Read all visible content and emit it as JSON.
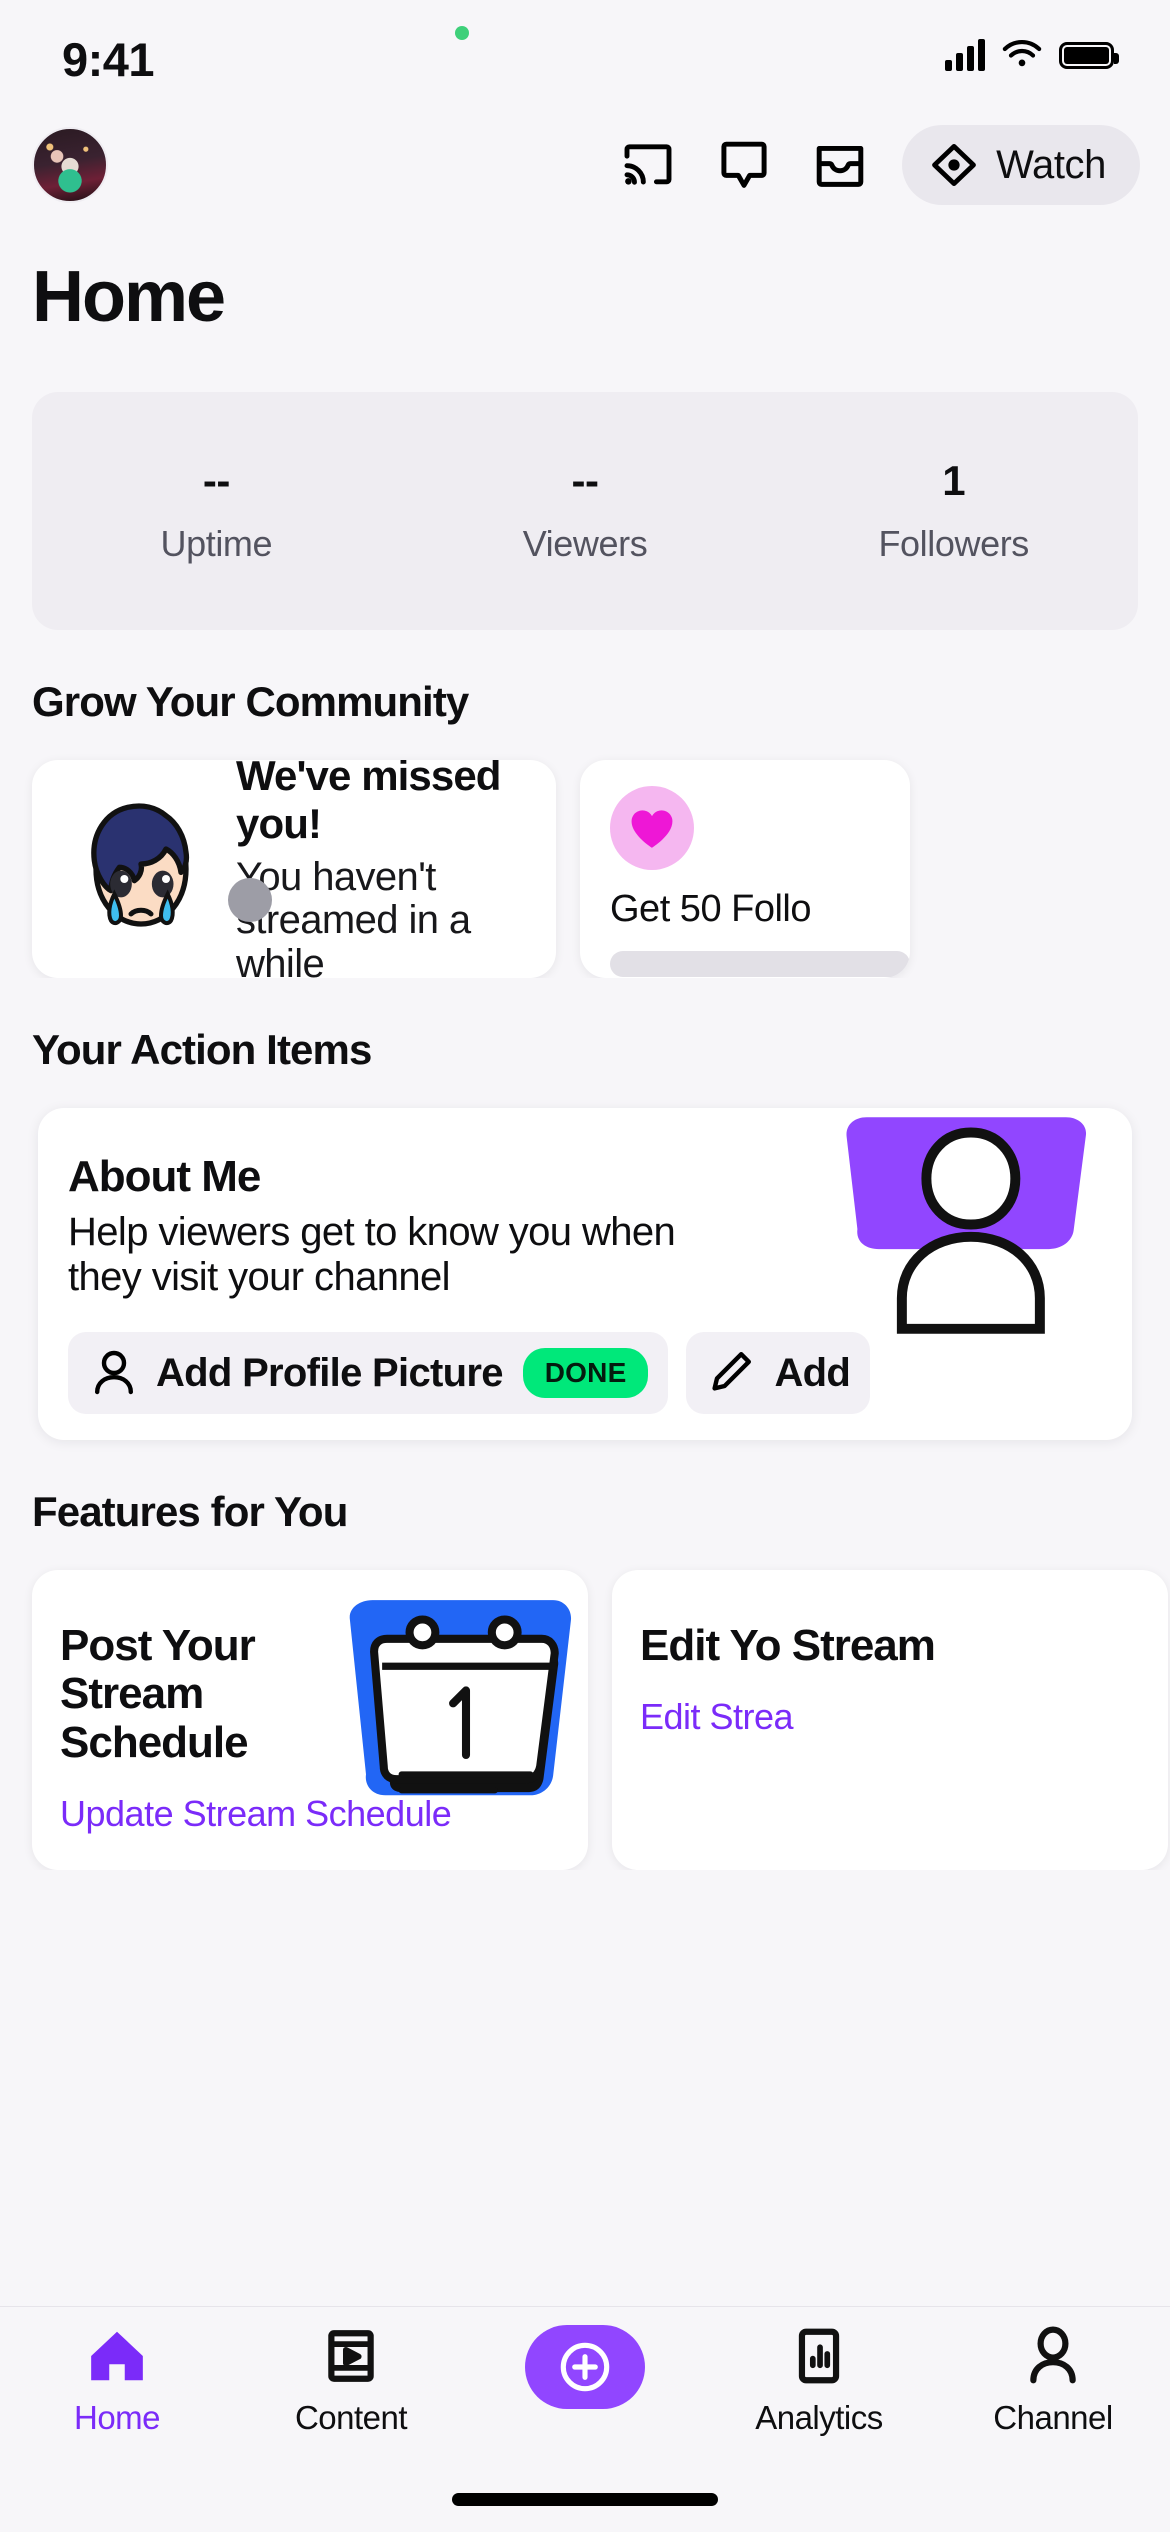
{
  "status_bar": {
    "time": "9:41",
    "icons": [
      "cellular-signal-icon",
      "wifi-icon",
      "battery-icon"
    ],
    "recording_dot": true
  },
  "app_bar": {
    "avatar": "user-avatar",
    "icons": [
      "cast-icon",
      "chat-bubble-icon",
      "inbox-icon"
    ],
    "watch_label": "Watch",
    "watch_icon": "eye-icon"
  },
  "page": {
    "title": "Home"
  },
  "stats": {
    "items": [
      {
        "value": "--",
        "label": "Uptime"
      },
      {
        "value": "--",
        "label": "Viewers"
      },
      {
        "value": "1",
        "label": "Followers"
      }
    ]
  },
  "grow": {
    "section_title": "Grow Your Community",
    "cards": [
      {
        "icon": "crying-anime-emoji",
        "title": "We've missed you!",
        "desc": "You haven't streamed in a while"
      },
      {
        "icon": "heart-icon",
        "label": "Get 50 Follo",
        "progress": 0
      }
    ]
  },
  "action_items": {
    "section_title": "Your Action Items",
    "card": {
      "title": "About Me",
      "desc": "Help viewers get to know you when they visit your channel",
      "art": "purple-person-illustration",
      "buttons": [
        {
          "icon": "person-icon",
          "label": "Add Profile Picture",
          "badge": "DONE"
        },
        {
          "icon": "pencil-icon",
          "label": "Add"
        }
      ]
    }
  },
  "features": {
    "section_title": "Features for You",
    "cards": [
      {
        "title": "Post Your Stream Schedule",
        "link": "Update Stream Schedule",
        "link_icon": "chevron-right-icon",
        "art": "calendar-illustration"
      },
      {
        "title": "Edit Yo Stream",
        "link": "Edit Strea",
        "link_icon": "chevron-right-icon",
        "art": "stream-illustration"
      }
    ]
  },
  "bottom_nav": {
    "items": [
      {
        "label": "Home",
        "icon": "home-icon",
        "active": true
      },
      {
        "label": "Content",
        "icon": "content-icon",
        "active": false
      },
      {
        "label": "",
        "icon": "go-live-plus-icon",
        "active": false
      },
      {
        "label": "Analytics",
        "icon": "analytics-icon",
        "active": false
      },
      {
        "label": "Channel",
        "icon": "channel-person-icon",
        "active": false
      }
    ]
  },
  "colors": {
    "accent_purple": "#9146FF",
    "link_purple": "#7B2BF9",
    "done_green": "#00E87A",
    "heart_pink": "#EE17D6",
    "background": "#F7F6F9"
  }
}
